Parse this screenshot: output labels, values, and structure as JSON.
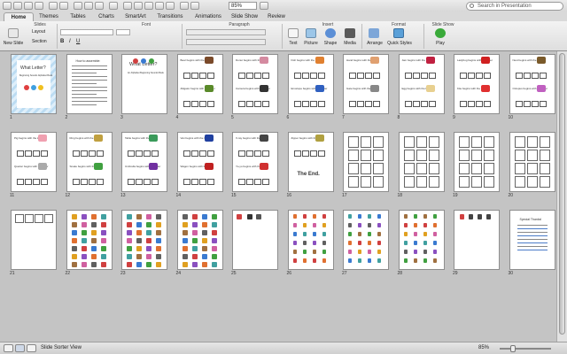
{
  "toolbar": {
    "zoom": "85%",
    "search_placeholder": "Search in Presentation"
  },
  "tabs": [
    {
      "label": "Home",
      "active": true
    },
    {
      "label": "Themes"
    },
    {
      "label": "Tables"
    },
    {
      "label": "Charts"
    },
    {
      "label": "SmartArt"
    },
    {
      "label": "Transitions"
    },
    {
      "label": "Animations"
    },
    {
      "label": "Slide Show"
    },
    {
      "label": "Review"
    }
  ],
  "ribbon": {
    "groups": {
      "slides": "Slides",
      "font": "Font",
      "paragraph": "Paragraph",
      "insert": "Insert",
      "format": "Format",
      "slideshow": "Slide Show"
    },
    "new_slide": "New Slide",
    "layout": "Layout",
    "section": "Section",
    "insert_buttons": [
      "Text",
      "Picture",
      "Shape",
      "Media"
    ],
    "arrange": "Arrange",
    "quick_styles": "Quick Styles",
    "play": "Play"
  },
  "slides": [
    {
      "n": "1",
      "title": "What Letter?",
      "sub": "Beginning Sounds Alphabet Book",
      "kind": "cover"
    },
    {
      "n": "2",
      "title": "How to assemble:",
      "kind": "text"
    },
    {
      "n": "3",
      "title": "What Letter?",
      "sub": "An Alphabet Beginning Sounds Book",
      "kind": "cover2"
    },
    {
      "n": "4",
      "w1": "Bear begins with the letter",
      "w2": "Alligator begins with the letter",
      "kind": "pair",
      "c1": "#7a4a2a",
      "c2": "#5a8a2a"
    },
    {
      "n": "5",
      "w1": "Donut begins with the letter",
      "w2": "Camera begins with the letter",
      "kind": "pair",
      "c1": "#d48aa0",
      "c2": "#333333"
    },
    {
      "n": "6",
      "w1": "Fish begins with the letter",
      "w2": "Envelope begins with the letter",
      "kind": "pair",
      "c1": "#e08030",
      "c2": "#3060c0"
    },
    {
      "n": "7",
      "w1": "Hand begins with the letter",
      "w2": "Gate begins with the letter",
      "kind": "pair",
      "c1": "#e0a070",
      "c2": "#888888"
    },
    {
      "n": "8",
      "w1": "Jam begins with the letter",
      "w2": "Egg begins with the letter",
      "kind": "pair",
      "c1": "#c02040",
      "c2": "#e8d090"
    },
    {
      "n": "9",
      "w1": "Ladybug begins with the letter",
      "w2": "Kite begins with the letter",
      "kind": "pair",
      "c1": "#d02020",
      "c2": "#e03030"
    },
    {
      "n": "10",
      "w1": "Nest begins with the letter",
      "w2": "Octopus begins with the letter",
      "kind": "pair",
      "c1": "#7a5a2a",
      "c2": "#c060c0"
    },
    {
      "n": "11",
      "w1": "Pig begins with the letter",
      "w2": "Quarter begins with the letter",
      "kind": "pair",
      "c1": "#f0a0b0",
      "c2": "#aaaaaa"
    },
    {
      "n": "12",
      "w1": "Ring begins with the letter",
      "w2": "Snake begins with the letter",
      "kind": "pair",
      "c1": "#c0a040",
      "c2": "#40a040"
    },
    {
      "n": "13",
      "w1": "Table begins with the letter",
      "w2": "Umbrella begins with the letter",
      "kind": "pair",
      "c1": "#3a9a5a",
      "c2": "#7030a0"
    },
    {
      "n": "14",
      "w1": "Van begins with the letter",
      "w2": "Wagon begins with the letter",
      "kind": "pair",
      "c1": "#2040a0",
      "c2": "#c02020"
    },
    {
      "n": "15",
      "w1": "X-ray begins with the letter",
      "w2": "Yo-yo begins with the letter",
      "kind": "pair",
      "c1": "#444444",
      "c2": "#d03030"
    },
    {
      "n": "16",
      "w1": "Zipper begins with the letter",
      "end": "The End.",
      "kind": "end",
      "c1": "#b0a040"
    },
    {
      "n": "17",
      "kind": "grid"
    },
    {
      "n": "18",
      "kind": "grid"
    },
    {
      "n": "19",
      "kind": "grid"
    },
    {
      "n": "20",
      "kind": "grid"
    },
    {
      "n": "21",
      "kind": "row"
    },
    {
      "n": "22",
      "kind": "pics"
    },
    {
      "n": "23",
      "kind": "pics"
    },
    {
      "n": "24",
      "kind": "pics"
    },
    {
      "n": "25",
      "kind": "few"
    },
    {
      "n": "26",
      "kind": "letters"
    },
    {
      "n": "27",
      "kind": "letters"
    },
    {
      "n": "28",
      "kind": "letters"
    },
    {
      "n": "29",
      "kind": "zz"
    },
    {
      "n": "30",
      "title": "Special Thanks!",
      "kind": "thanks"
    }
  ],
  "statusbar": {
    "view": "Slide Sorter View",
    "zoom": "85%"
  },
  "colors": {
    "accent": "#4a7bc8",
    "background": "#c4c4c4"
  }
}
